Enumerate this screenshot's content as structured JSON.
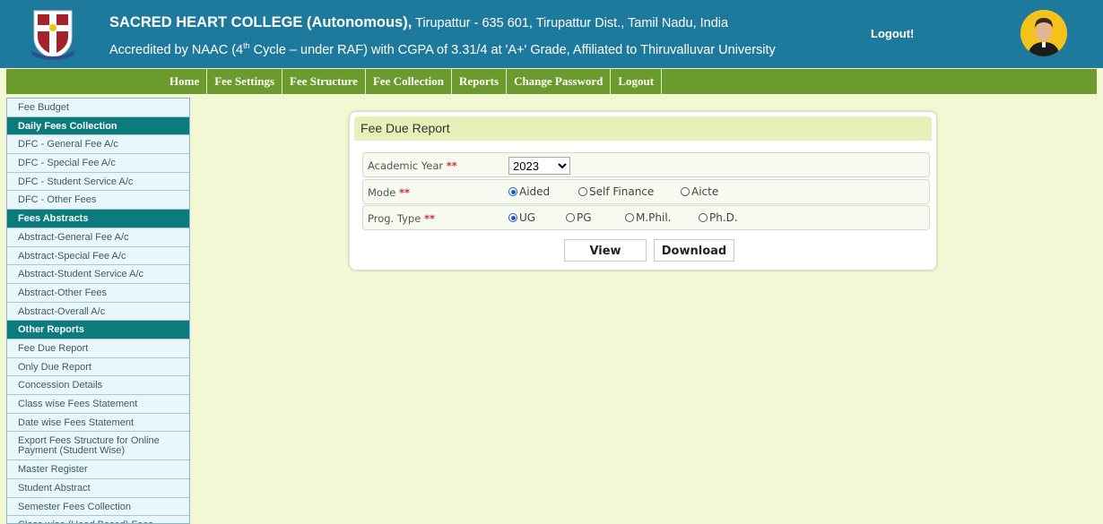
{
  "header": {
    "college_name": "SACRED HEART COLLEGE (Autonomous),",
    "address": " Tirupattur - 635 601, Tirupattur Dist., Tamil Nadu, India",
    "accreditation_pre": "Accredited by NAAC (4",
    "accreditation_sup": "th",
    "accreditation_post": " Cycle – under RAF) with CGPA of 3.31/4 at 'A+' Grade, Affiliated to Thiruvalluvar University",
    "logout_label": "Logout!"
  },
  "nav": {
    "items": [
      "Home",
      "Fee Settings",
      "Fee Structure",
      "Fee Collection",
      "Reports",
      "Change Password",
      "Logout"
    ]
  },
  "sidebar": {
    "items": [
      {
        "label": "Fee Budget",
        "type": "link"
      },
      {
        "label": "Daily Fees Collection",
        "type": "header"
      },
      {
        "label": "DFC - General Fee A/c",
        "type": "link"
      },
      {
        "label": "DFC - Special Fee A/c",
        "type": "link"
      },
      {
        "label": "DFC - Student Service A/c",
        "type": "link"
      },
      {
        "label": "DFC - Other Fees",
        "type": "link"
      },
      {
        "label": "Fees Abstracts",
        "type": "header"
      },
      {
        "label": "Abstract-General Fee A/c",
        "type": "link"
      },
      {
        "label": "Abstract-Special Fee A/c",
        "type": "link"
      },
      {
        "label": "Abstract-Student Service A/c",
        "type": "link"
      },
      {
        "label": "Abstract-Other Fees",
        "type": "link"
      },
      {
        "label": "Abstract-Overall A/c",
        "type": "link"
      },
      {
        "label": "Other Reports",
        "type": "header"
      },
      {
        "label": "Fee Due Report",
        "type": "link"
      },
      {
        "label": "Only Due Report",
        "type": "link"
      },
      {
        "label": "Concession Details",
        "type": "link"
      },
      {
        "label": "Class wise Fees Statement",
        "type": "link"
      },
      {
        "label": "Date wise Fees Statement",
        "type": "link"
      },
      {
        "label": "Export Fees Structure for Online Payment (Student Wise)",
        "type": "link",
        "tall": true
      },
      {
        "label": "Master Register",
        "type": "link"
      },
      {
        "label": "Student Abstract",
        "type": "link"
      },
      {
        "label": "Semester Fees Collection",
        "type": "link"
      },
      {
        "label": "Class wise (Head Based) Fees",
        "type": "link"
      }
    ]
  },
  "form": {
    "title": "Fee Due Report",
    "required_mark": "**",
    "academic_year": {
      "label": "Academic Year",
      "value": "2023"
    },
    "mode": {
      "label": "Mode",
      "options": [
        "Aided",
        "Self Finance",
        "Aicte"
      ],
      "selected": "Aided"
    },
    "prog_type": {
      "label": "Prog. Type",
      "options": [
        "UG",
        "PG",
        "M.Phil.",
        "Ph.D."
      ],
      "selected": "UG"
    },
    "view_label": "View",
    "download_label": "Download"
  },
  "colors": {
    "header_bg": "#1e7a9c",
    "nav_bg": "#6a9b2c",
    "page_bg": "#f4f7d4",
    "sidebar_header_bg": "#0d7a7d",
    "card_title_bg": "#e9efb8",
    "required": "#d0342c"
  }
}
